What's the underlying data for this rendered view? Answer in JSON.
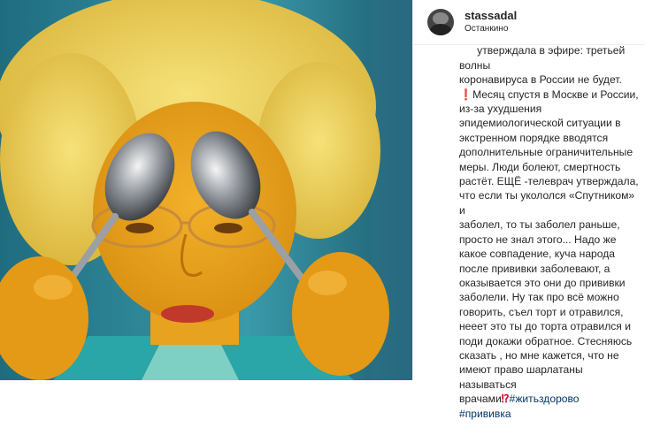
{
  "post": {
    "username": "stassadal",
    "location": "Останкино",
    "caption_lines": [
      "утверждала в эфире: третьей волны",
      "коронавируса в России не будет.",
      "Месяц спустя в Москве и России,",
      "из-за ухудшения",
      "эпидемиологической ситуации в",
      "экстренном порядке вводятся",
      "дополнительные ограничительные",
      "меры. Люди болеют, смертность",
      "растёт. ЕЩЁ -телеврач утверждала,",
      "что если ты укололся «Спутником» и",
      "заболел, то ты заболел раньше,",
      "просто не знал этого... Надо же",
      "какое совпадение, куча народа",
      "после прививки заболевают, а",
      "оказывается это они до прививки",
      "заболели. Ну так про всё можно",
      "говорить, съел торт и отравился,",
      "нееет это ты до торта отравился и",
      "поди докажи обратное. Стесняюсь",
      "сказать , но мне кажется, что не",
      "имеют право шарлатаны называться",
      "врачами"
    ],
    "emoji_exclamation": "❗",
    "emoji_interrobang": "⁉",
    "hashtags": [
      "#житьздорово",
      "#прививка"
    ]
  }
}
